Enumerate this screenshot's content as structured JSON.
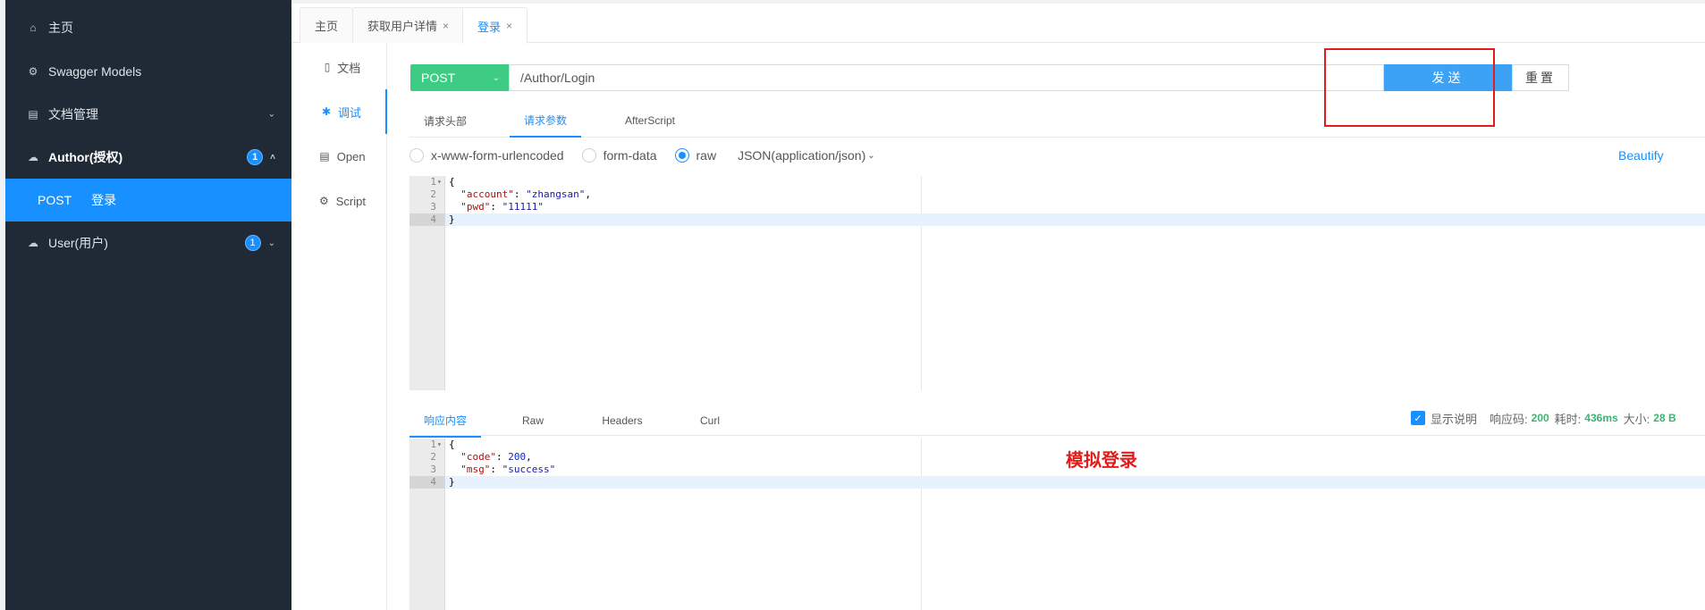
{
  "sidebar": {
    "items": [
      {
        "label": "主页",
        "icon": "home-icon"
      },
      {
        "label": "Swagger Models",
        "icon": "cube-icon"
      },
      {
        "label": "文档管理",
        "icon": "doc-manage-icon"
      },
      {
        "label": "Author(授权)",
        "icon": "cloud-icon",
        "badge": "1"
      },
      {
        "method": "POST",
        "label": "登录"
      },
      {
        "label": "User(用户)",
        "icon": "cloud-icon",
        "badge": "1"
      }
    ]
  },
  "tabs": [
    {
      "label": "主页"
    },
    {
      "label": "获取用户详情"
    },
    {
      "label": "登录"
    }
  ],
  "tab_close": "×",
  "vnav": [
    {
      "label": "文档",
      "icon": "document-icon"
    },
    {
      "label": "调试",
      "icon": "bug-icon"
    },
    {
      "label": "Open",
      "icon": "file-icon"
    },
    {
      "label": "Script",
      "icon": "script-icon"
    }
  ],
  "request": {
    "method": "POST",
    "url": "/Author/Login",
    "send_label": "发送",
    "reset_label": "重置"
  },
  "request_tabs": [
    "请求头部",
    "请求参数",
    "AfterScript"
  ],
  "body_types": [
    "x-www-form-urlencoded",
    "form-data",
    "raw"
  ],
  "content_type": "JSON(application/json)",
  "beautify": "Beautify",
  "request_body": {
    "lines": [
      {
        "num": "1",
        "code": "{"
      },
      {
        "num": "2",
        "key": "\"account\"",
        "value": "\"zhangsan\"",
        "comma": ","
      },
      {
        "num": "3",
        "key": "\"pwd\"",
        "value": "\"11111\"",
        "comma": ""
      },
      {
        "num": "4",
        "code": "}"
      }
    ]
  },
  "response_tabs": [
    "响应内容",
    "Raw",
    "Headers",
    "Curl"
  ],
  "response_meta": {
    "show_desc_label": "显示说明",
    "code_label": "响应码:",
    "code": "200",
    "time_label": "耗时:",
    "time": "436ms",
    "size_label": "大小:",
    "size": "28 B"
  },
  "response_body": {
    "lines": [
      {
        "num": "1",
        "code": "{"
      },
      {
        "num": "2",
        "key": "\"code\"",
        "value": "200",
        "comma": ","
      },
      {
        "num": "3",
        "key": "\"msg\"",
        "value": "\"success\"",
        "comma": ""
      },
      {
        "num": "4",
        "code": "}"
      }
    ]
  },
  "annotation": "模拟登录",
  "colors": {
    "accent": "#1890ff",
    "method": "#3ecb83",
    "highlight_box": "#e31b1b"
  }
}
